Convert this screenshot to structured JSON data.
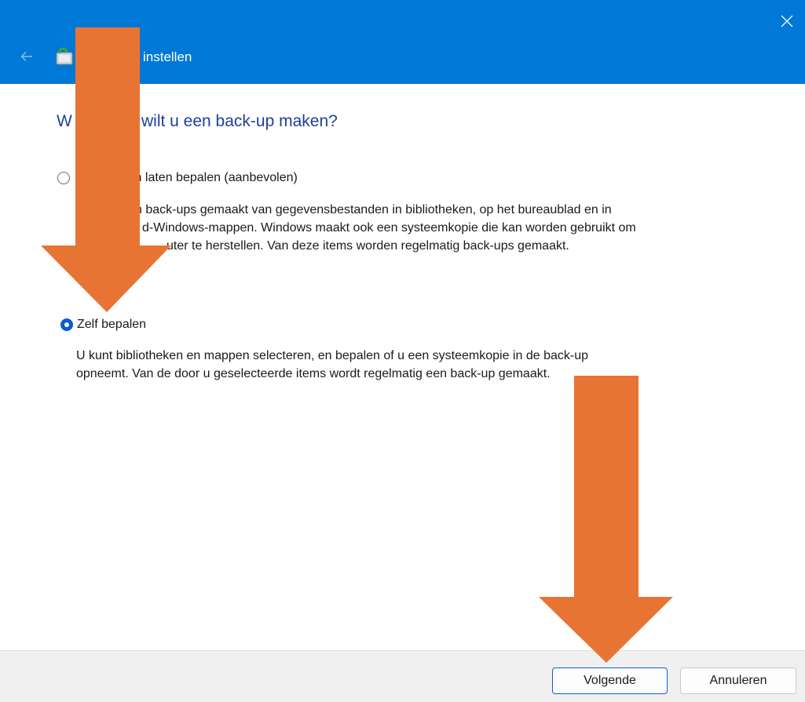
{
  "window": {
    "title": "instellen"
  },
  "heading": {
    "start": "W",
    "rest": "wilt u een back-up maken?"
  },
  "options": [
    {
      "label": "isch laten bepalen (aanbevolen)",
      "selected": false,
      "description_lines": [
        "n back-ups gemaakt van gegevensbestanden in bibliotheken, op het bureaublad en in",
        "d-Windows-mappen. Windows maakt ook een systeemkopie die kan worden gebruikt om",
        "uter te herstellen. Van deze items worden regelmatig back-ups gemaakt."
      ]
    },
    {
      "label": "Zelf bepalen",
      "selected": true,
      "description_lines": [
        "U kunt bibliotheken en mappen selecteren, en bepalen of u een systeemkopie in de back-up",
        "opneemt. Van de door u geselecteerde items wordt regelmatig een back-up gemaakt."
      ]
    }
  ],
  "footer": {
    "next_label": "Volgende",
    "cancel_label": "Annuleren"
  },
  "icons": {
    "close": "close-icon",
    "back": "back-arrow-icon",
    "app": "backup-app-icon"
  },
  "colors": {
    "titlebar": "#0078d7",
    "heading": "#1e3f9a",
    "accent": "#0a5ccd",
    "annotation_arrow": "#e87434",
    "footer": "#f0f0f0"
  }
}
